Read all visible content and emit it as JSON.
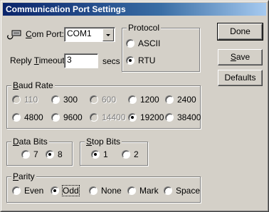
{
  "window": {
    "title": "Communication Port Settings"
  },
  "com_port": {
    "label_prefix": "",
    "label_ul": "C",
    "label_rest": "om Port:",
    "value": "COM1"
  },
  "reply_timeout": {
    "label_pre": "Reply ",
    "label_ul": "T",
    "label_rest": "imeout:",
    "value": "3",
    "unit": "secs"
  },
  "protocol": {
    "legend": "Protocol",
    "options": [
      {
        "label": "ASCII",
        "selected": false
      },
      {
        "label": "RTU",
        "selected": true
      }
    ]
  },
  "buttons": {
    "done": "Done",
    "save_ul": "S",
    "save_rest": "ave",
    "defaults": "Defaults"
  },
  "baud_rate": {
    "legend_ul": "B",
    "legend_rest": "aud Rate",
    "options": [
      {
        "label": "110",
        "selected": false,
        "enabled": false
      },
      {
        "label": "300",
        "selected": false,
        "enabled": true
      },
      {
        "label": "600",
        "selected": false,
        "enabled": false
      },
      {
        "label": "1200",
        "selected": false,
        "enabled": true
      },
      {
        "label": "2400",
        "selected": false,
        "enabled": true
      },
      {
        "label": "4800",
        "selected": false,
        "enabled": true
      },
      {
        "label": "9600",
        "selected": false,
        "enabled": true
      },
      {
        "label": "14400",
        "selected": false,
        "enabled": false
      },
      {
        "label": "19200",
        "selected": true,
        "enabled": true
      },
      {
        "label": "38400",
        "selected": false,
        "enabled": true
      }
    ]
  },
  "data_bits": {
    "legend_ul": "D",
    "legend_rest": "ata Bits",
    "options": [
      {
        "label": "7",
        "selected": false
      },
      {
        "label": "8",
        "selected": true
      }
    ]
  },
  "stop_bits": {
    "legend_ul": "S",
    "legend_rest": "top Bits",
    "options": [
      {
        "label": "1",
        "selected": true
      },
      {
        "label": "2",
        "selected": false
      }
    ]
  },
  "parity": {
    "legend_ul": "P",
    "legend_rest": "arity",
    "options": [
      {
        "label": "Even",
        "selected": false
      },
      {
        "label": "Odd",
        "selected": true,
        "focused": true
      },
      {
        "label": "None",
        "selected": false
      },
      {
        "label": "Mark",
        "selected": false
      },
      {
        "label": "Space",
        "selected": false
      }
    ]
  },
  "icons": {
    "com_port": "serial-cable-icon",
    "dropdown": "chevron-down-icon"
  }
}
